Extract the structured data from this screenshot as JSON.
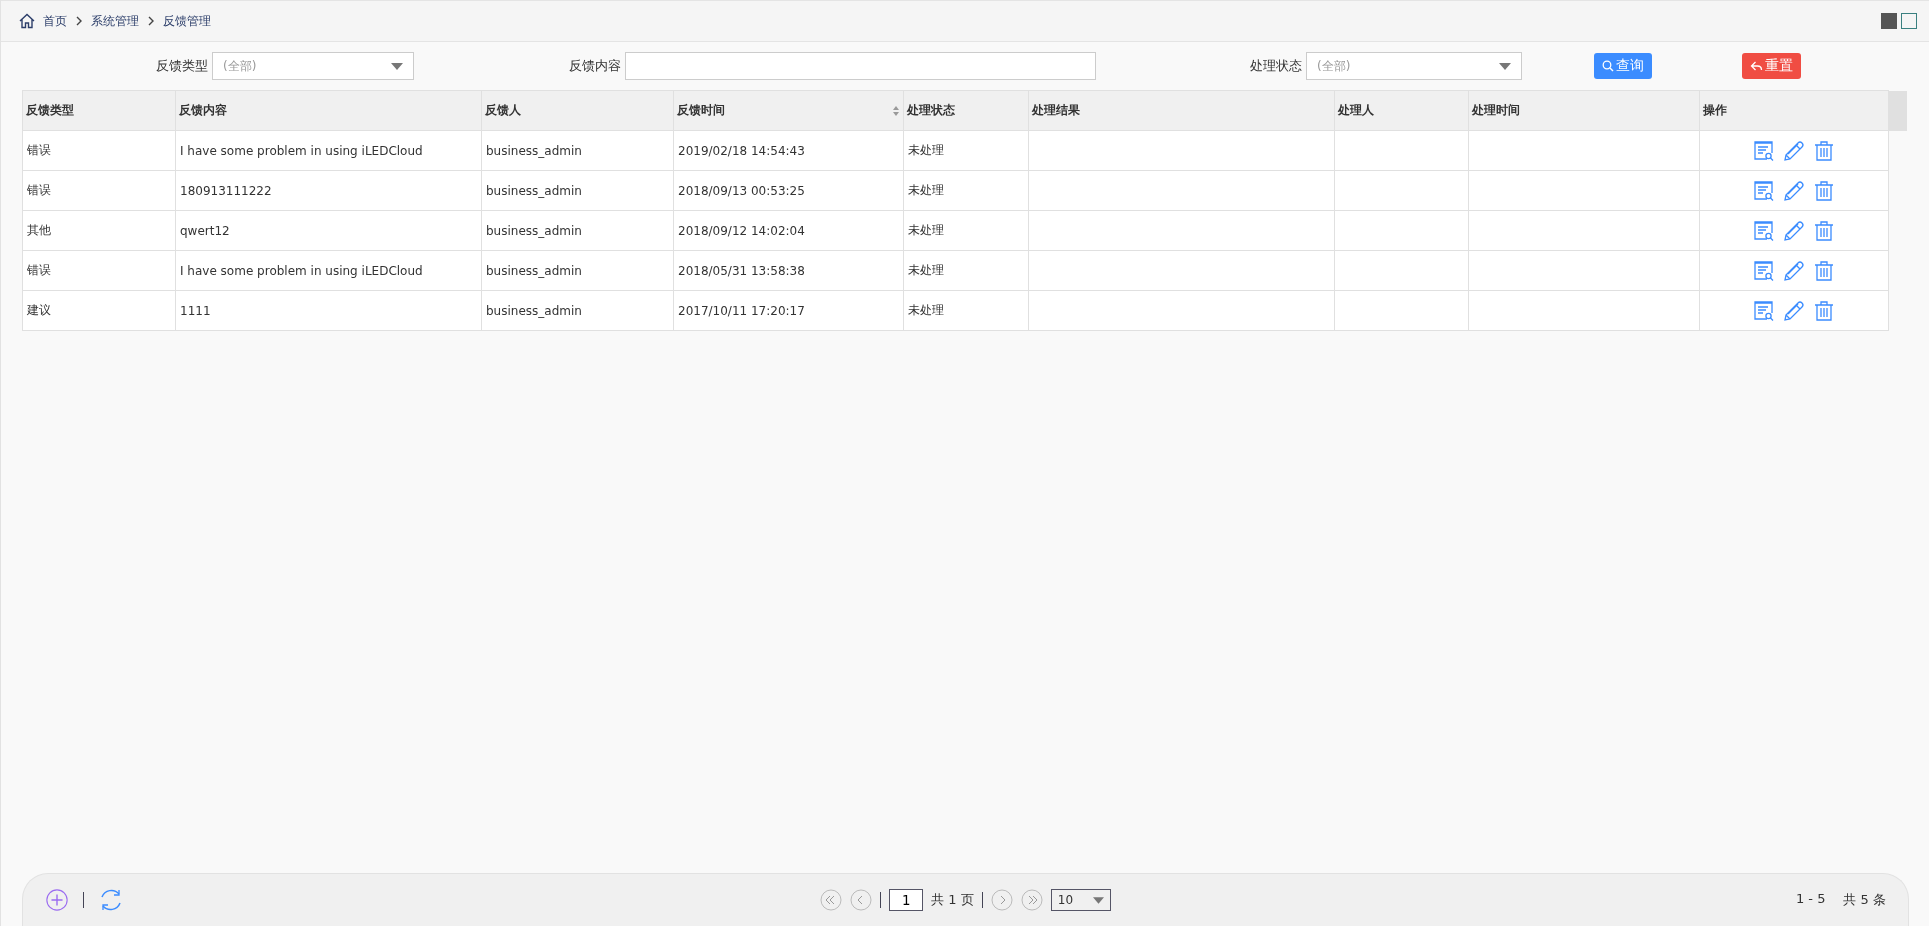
{
  "breadcrumb": [
    "首页",
    "系统管理",
    "反馈管理"
  ],
  "filters": [
    {
      "kind": "select",
      "label": "反馈类型",
      "placeholder": "(全部)"
    },
    {
      "kind": "text",
      "label": "反馈内容"
    },
    {
      "kind": "select",
      "label": "处理状态",
      "placeholder": "(全部)"
    }
  ],
  "buttons": [
    {
      "kind": "search",
      "label": "查询"
    },
    {
      "kind": "reset",
      "label": "重置"
    }
  ],
  "table": {
    "columns": [
      {
        "label": "反馈类型",
        "sortable": false
      },
      {
        "label": "反馈内容",
        "sortable": false
      },
      {
        "label": "反馈人",
        "sortable": false
      },
      {
        "label": "反馈时间",
        "sortable": true
      },
      {
        "label": "处理状态",
        "sortable": false
      },
      {
        "label": "处理结果",
        "sortable": false
      },
      {
        "label": "处理人",
        "sortable": false
      },
      {
        "label": "处理时间",
        "sortable": false
      },
      {
        "label": "操作",
        "sortable": false
      }
    ],
    "rows": [
      {
        "cells": [
          "错误",
          "I have some problem in using iLEDCloud",
          "business_admin",
          "2019/02/18 14:54:43",
          "未处理"
        ]
      },
      {
        "cells": [
          "错误",
          "180913111222",
          "business_admin",
          "2018/09/13 00:53:25",
          "未处理"
        ]
      },
      {
        "cells": [
          "其他",
          "qwert12",
          "business_admin",
          "2018/09/12 14:02:04",
          "未处理"
        ]
      },
      {
        "cells": [
          "错误",
          "I have some problem in using iLEDCloud",
          "business_admin",
          "2018/05/31 13:58:38",
          "未处理"
        ]
      },
      {
        "cells": [
          "建议",
          "1111",
          "business_admin",
          "2017/10/11 17:20:17",
          "未处理"
        ]
      }
    ]
  },
  "pager": {
    "page": "1",
    "total_pages": "共 1 页",
    "page_size": "10",
    "range": "1 - 5",
    "total": "共 5 条"
  }
}
